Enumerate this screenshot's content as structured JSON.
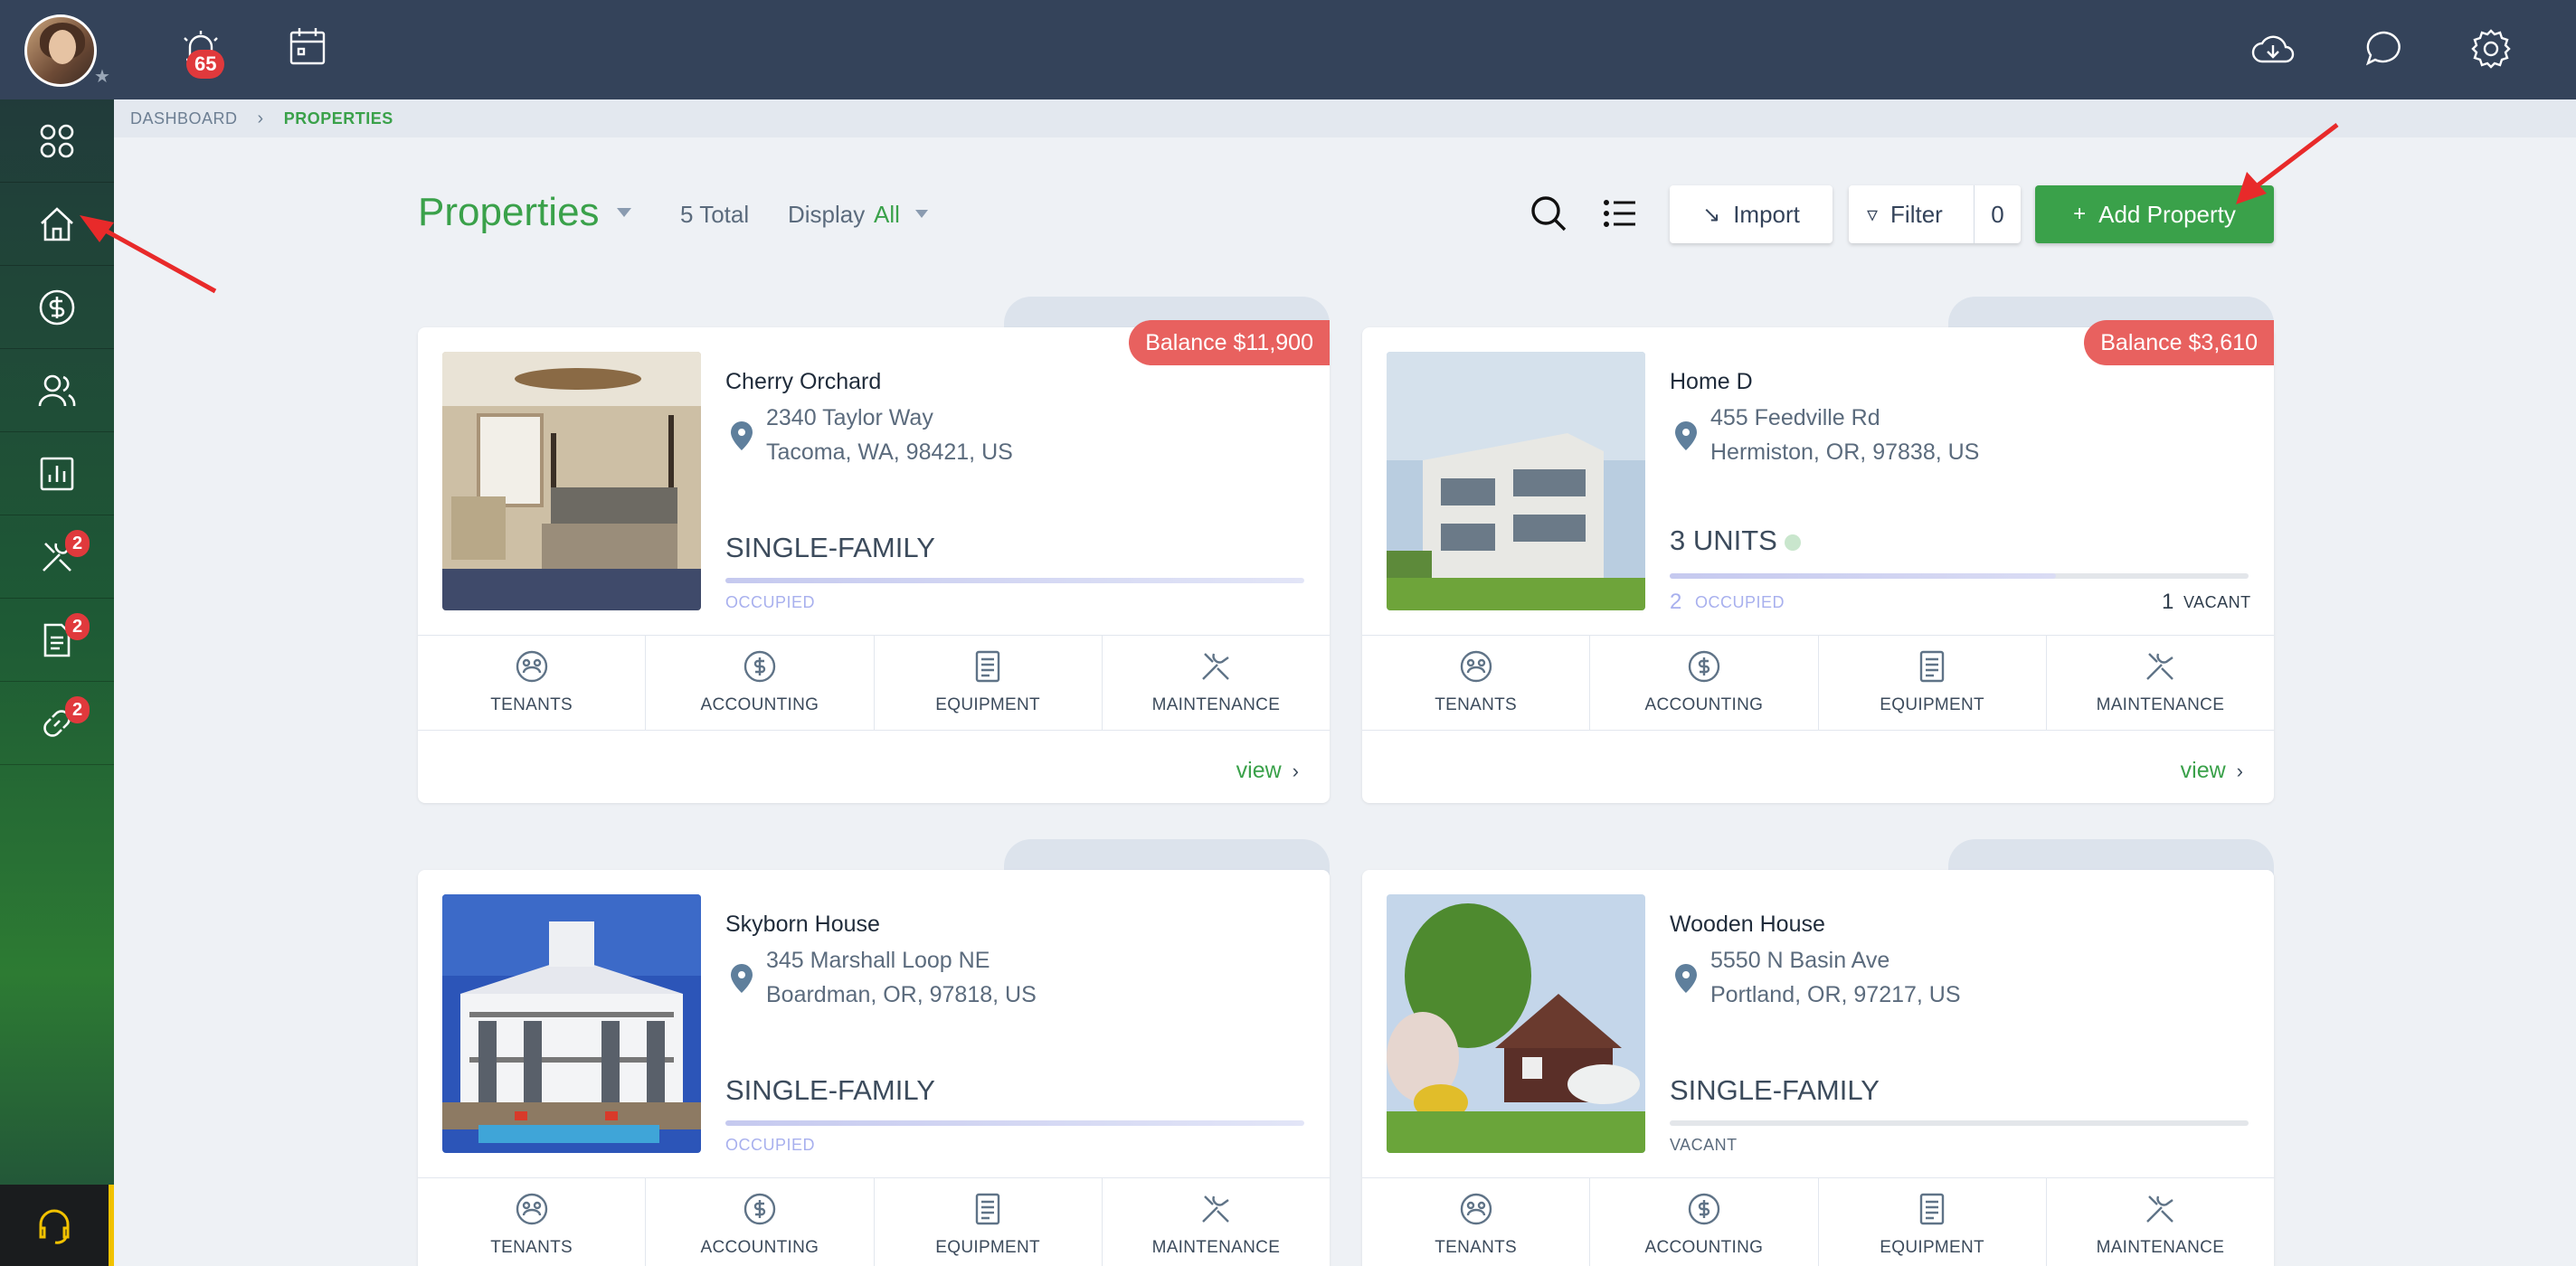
{
  "topbar": {
    "alerts_count": "65",
    "icons": [
      "bell-alert-icon",
      "calendar-icon",
      "cloud-download-icon",
      "chat-icon",
      "gear-icon"
    ]
  },
  "sidebar": {
    "items": [
      {
        "name": "dashboard",
        "icon": "grid-icon",
        "badge": ""
      },
      {
        "name": "properties",
        "icon": "home-icon",
        "badge": ""
      },
      {
        "name": "accounting",
        "icon": "dollar-icon",
        "badge": ""
      },
      {
        "name": "people",
        "icon": "users-icon",
        "badge": ""
      },
      {
        "name": "reports",
        "icon": "chart-icon",
        "badge": ""
      },
      {
        "name": "maintenance",
        "icon": "tools-icon",
        "badge": "2"
      },
      {
        "name": "documents",
        "icon": "document-icon",
        "badge": "2"
      },
      {
        "name": "links",
        "icon": "link-icon",
        "badge": "2"
      }
    ]
  },
  "breadcrumb": {
    "root": "DASHBOARD",
    "current": "PROPERTIES"
  },
  "header": {
    "title": "Properties",
    "total": "5 Total",
    "display_label": "Display",
    "display_value": "All",
    "import_label": "Import",
    "filter_label": "Filter",
    "filter_count": "0",
    "add_label": "Add Property"
  },
  "actions": [
    "TENANTS",
    "ACCOUNTING",
    "EQUIPMENT",
    "MAINTENANCE"
  ],
  "view_label": "view",
  "properties": [
    {
      "name": "Cherry Orchard",
      "address_line1": "2340 Taylor Way",
      "address_line2": "Tacoma, WA, 98421, US",
      "type": "SINGLE-FAMILY",
      "status": "OCCUPIED",
      "balance": "Balance $11,900"
    },
    {
      "name": "Home D",
      "address_line1": "455 Feedville Rd",
      "address_line2": "Hermiston, OR, 97838, US",
      "type": "3 UNITS",
      "occupied_count": "2",
      "occupied_label": "OCCUPIED",
      "vacant_count": "1",
      "vacant_label": "VACANT",
      "occupied_fraction": 0.667,
      "balance": "Balance $3,610"
    },
    {
      "name": "Skyborn House",
      "address_line1": "345 Marshall Loop NE",
      "address_line2": "Boardman, OR, 97818, US",
      "type": "SINGLE-FAMILY",
      "status": "OCCUPIED"
    },
    {
      "name": "Wooden House",
      "address_line1": "5550 N Basin Ave",
      "address_line2": "Portland, OR, 97217, US",
      "type": "SINGLE-FAMILY",
      "status": "VACANT"
    }
  ],
  "colors": {
    "accent": "#3aa14a",
    "topbar": "#34435a",
    "balance": "#e8615f",
    "badge": "#e0393c"
  }
}
